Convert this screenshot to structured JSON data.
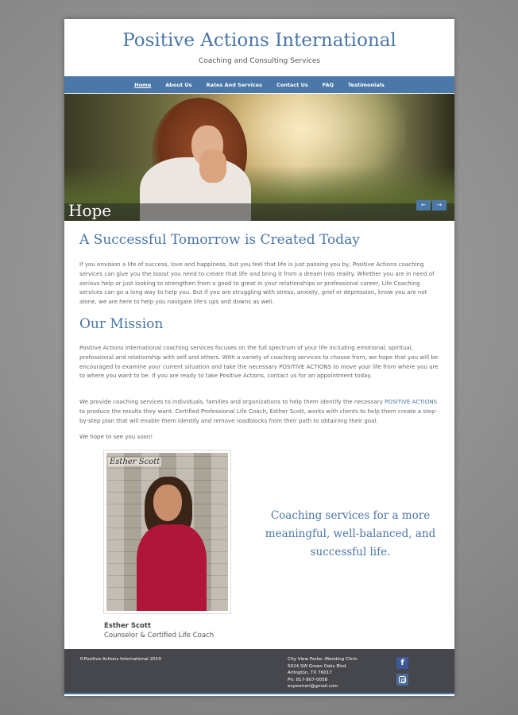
{
  "header": {
    "title": "Positive Actions International",
    "subtitle": "Coaching and Consulting Services"
  },
  "nav": {
    "items": [
      {
        "label": "Home",
        "active": true
      },
      {
        "label": "About Us"
      },
      {
        "label": "Rates And Services"
      },
      {
        "label": "Contact Us"
      },
      {
        "label": "FAQ"
      },
      {
        "label": "Testimonials"
      }
    ]
  },
  "hero": {
    "caption": "Hope",
    "prev_label": "←",
    "next_label": "→"
  },
  "section1": {
    "heading": "A Successful Tomorrow is Created Today",
    "body": "If you envision a life of success, love and happiness, but you feel that life is just passing you by, Positive Actions coaching services can give you the boost you need to create that life and bring it from a dream into reality. Whether you are in need of serious help or just looking to strengthen from a good to great in your relationships or professional career, Life Coaching services can go a long way to help you. But if you are struggling with stress, anxiety, grief or depression, know you are not alone, we are here to help you navigate life's ups and downs as well."
  },
  "section2": {
    "heading": "Our Mission",
    "para1": "Positive Actions International coaching services focuses on the full spectrum of your life including emotional, spiritual, professional and  relationship with self and others.  With a variety of coaching services to choose from, we hope that you will be encouraged to examine your current situation and take the necessary POSITIVE ACTIONS to move your life from where you are to where you want to be.  If you are ready to take Positive Actions, contact us for an appointment today.",
    "para2_before": "We provide coaching services to individuals, families and organizations to help them identify the necessary ",
    "para2_highlight": "POSITIVE ACTIONS",
    "para2_after": " to produce the results they want. Certified Professional Life Coach, Esther Scott, works with  clients to help them create a step-by-step plan that will enable them identify and remove roadblocks from their path to obtaining their goal.",
    "para3": "We hope to see you soon!"
  },
  "profile": {
    "photo_label": "Esther Scott",
    "name": "Esther Scott",
    "role": "Counselor & Certified Life Coach"
  },
  "quote": "Coaching services for a more meaningful, well-balanced, and successful life.",
  "footer": {
    "copyright": "©Positive Actions International 2019",
    "address_lines": [
      "City View Parke--Mending Clinic",
      "5624 SW Green Oaks Blvd",
      "Arlington, TX 76017",
      "Ph: 817-807-0058",
      "esyesmeri@gmail.com"
    ],
    "facebook_letter": "f"
  },
  "colors": {
    "brand_blue": "#4a76a8",
    "footer_bg": "#46464d"
  }
}
